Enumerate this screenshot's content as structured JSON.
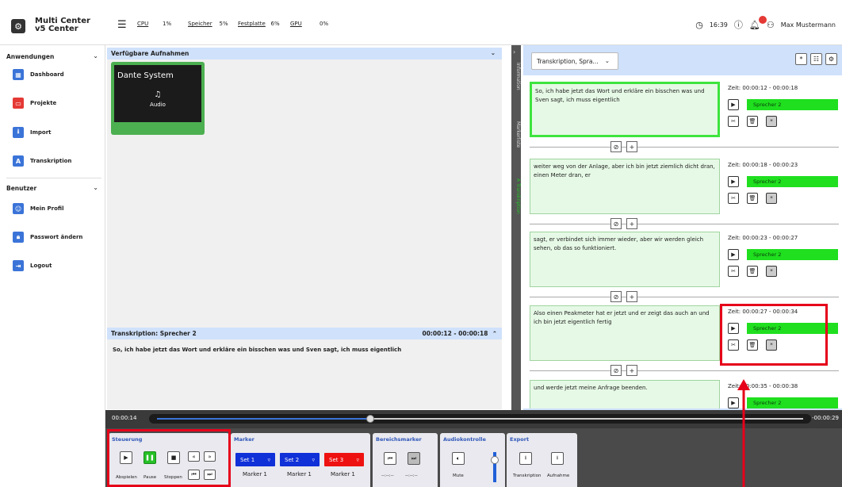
{
  "app": {
    "title": "Multi Center v5 Center"
  },
  "header": {
    "stats": [
      {
        "label": "CPU",
        "value": "1%"
      },
      {
        "label": "Speicher",
        "value": "5%"
      },
      {
        "label": "Festplatte",
        "value": "6%"
      },
      {
        "label": "GPU",
        "value": "0%"
      }
    ],
    "time": "16:39",
    "user": "Max Mustermann"
  },
  "sidebar": {
    "group1": "Anwendungen",
    "items1": [
      "Dashboard",
      "Projekte",
      "Import",
      "Transkription"
    ],
    "group2": "Benutzer",
    "items2": [
      "Mein Profil",
      "Passwort ändern",
      "Logout"
    ]
  },
  "center": {
    "available_title": "Verfügbare Aufnahmen",
    "card_title": "Dante System",
    "card_type": "Audio",
    "transcription_title": "Transkription: Sprecher 2",
    "transcription_time": "00:00:12 - 00:00:18",
    "transcription_text": "So, ich habe jetzt das Wort und erkläre ein bisschen was und Sven sagt, ich muss eigentlich"
  },
  "vtabs": [
    "Information",
    "Markerliste",
    "A Transkription"
  ],
  "right": {
    "dropdown": "Transkription, Spra...",
    "segments": [
      {
        "text": "So, ich habe jetzt das Wort und erkläre ein bisschen was und Sven sagt, ich muss eigentlich",
        "time": "Zeit: 00:00:12 - 00:00:18",
        "speaker": "Sprecher 2"
      },
      {
        "text": "weiter weg von der Anlage, aber ich bin jetzt ziemlich dicht dran, einen Meter dran, er",
        "time": "Zeit: 00:00:18 - 00:00:23",
        "speaker": "Sprecher 2"
      },
      {
        "text": "sagt, er verbindet sich immer wieder, aber wir werden gleich sehen, ob das so funktioniert.",
        "time": "Zeit: 00:00:23 - 00:00:27",
        "speaker": "Sprecher 2"
      },
      {
        "text": "Also einen Peakmeter hat er jetzt und er zeigt das auch an und ich bin jetzt eigentlich fertig",
        "time": "Zeit: 00:00:27 - 00:00:34",
        "speaker": "Sprecher 2"
      },
      {
        "text": "und werde jetzt meine Anfrage beenden.",
        "time": "Zeit: 00:00:35 - 00:00:38",
        "speaker": "Sprecher 2"
      }
    ]
  },
  "timeline": {
    "current": "00:00:14",
    "remaining": "-00:00:29",
    "progress": 0.33
  },
  "controls": {
    "steuerung": "Steuerung",
    "play_label": "Abspielen",
    "pause_label": "Pause",
    "stop_label": "Stoppen",
    "marker_title": "Marker",
    "sets": [
      {
        "label": "Set 1",
        "marker": "Marker 1",
        "color": "#1030d8"
      },
      {
        "label": "Set 2",
        "marker": "Marker 1",
        "color": "#1030d8"
      },
      {
        "label": "Set 3",
        "marker": "Marker 1",
        "color": "#ee1111"
      }
    ],
    "bereich_title": "Bereichsmarker",
    "bereich_val": "--:--:--",
    "audio_title": "Audiokontrolle",
    "mute_label": "Mute",
    "export_title": "Export",
    "export_labels": [
      "Transkription",
      "Aufnahme"
    ]
  }
}
